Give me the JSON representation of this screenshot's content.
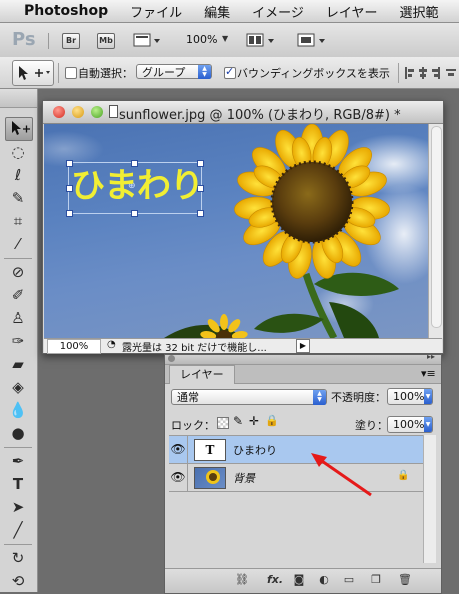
{
  "menubar": {
    "app_name": "Photoshop",
    "items": [
      "ファイル",
      "編集",
      "イメージ",
      "レイヤー",
      "選択範"
    ]
  },
  "appbar": {
    "logo": "Ps",
    "br": "Br",
    "mb": "Mb",
    "zoom": "100%"
  },
  "options": {
    "auto_select_label": "自動選択：",
    "auto_select_value": "グループ",
    "bbox_label": "バウンディングボックスを表示"
  },
  "document": {
    "title": "sunflower.jpg @ 100% (ひまわり, RGB/8#) *",
    "canvas_text": "ひまわり",
    "zoom": "100%",
    "status_text": "露光量は 32 bit だけで機能し..."
  },
  "layers": {
    "tab": "レイヤー",
    "blend_mode": "通常",
    "opacity_label": "不透明度：",
    "opacity": "100%",
    "lock_label": "ロック：",
    "fill_label": "塗り：",
    "fill": "100%",
    "rows": [
      {
        "name": "ひまわり",
        "thumb": "T"
      },
      {
        "name": "背景"
      }
    ],
    "footer_fx": "fx."
  },
  "colors": {
    "selection": "#a9c8ef",
    "text_yellow": "#f1ee33",
    "arrow": "#e51a1a"
  }
}
